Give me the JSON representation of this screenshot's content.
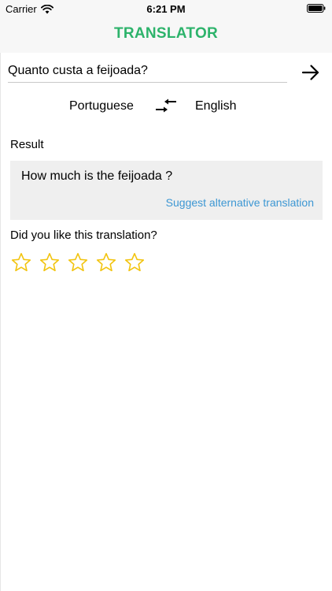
{
  "status_bar": {
    "carrier": "Carrier",
    "time": "6:21 PM"
  },
  "app": {
    "title": "TRANSLATOR",
    "title_color": "#2db36b"
  },
  "input": {
    "value": "Quanto custa a feijoada?"
  },
  "languages": {
    "source": "Portuguese",
    "target": "English"
  },
  "result": {
    "label": "Result",
    "text": "How much is the feijoada ?",
    "suggest_label": "Suggest alternative translation",
    "link_color": "#3d97d3"
  },
  "rating": {
    "question": "Did you like this translation?",
    "max": 5,
    "value": 0,
    "star_color": "#f2c40f"
  },
  "icons": {
    "wifi": "wifi-icon",
    "battery": "battery-icon",
    "translate": "arrow-right-icon",
    "swap": "swap-icon",
    "star": "star-outline-icon"
  }
}
